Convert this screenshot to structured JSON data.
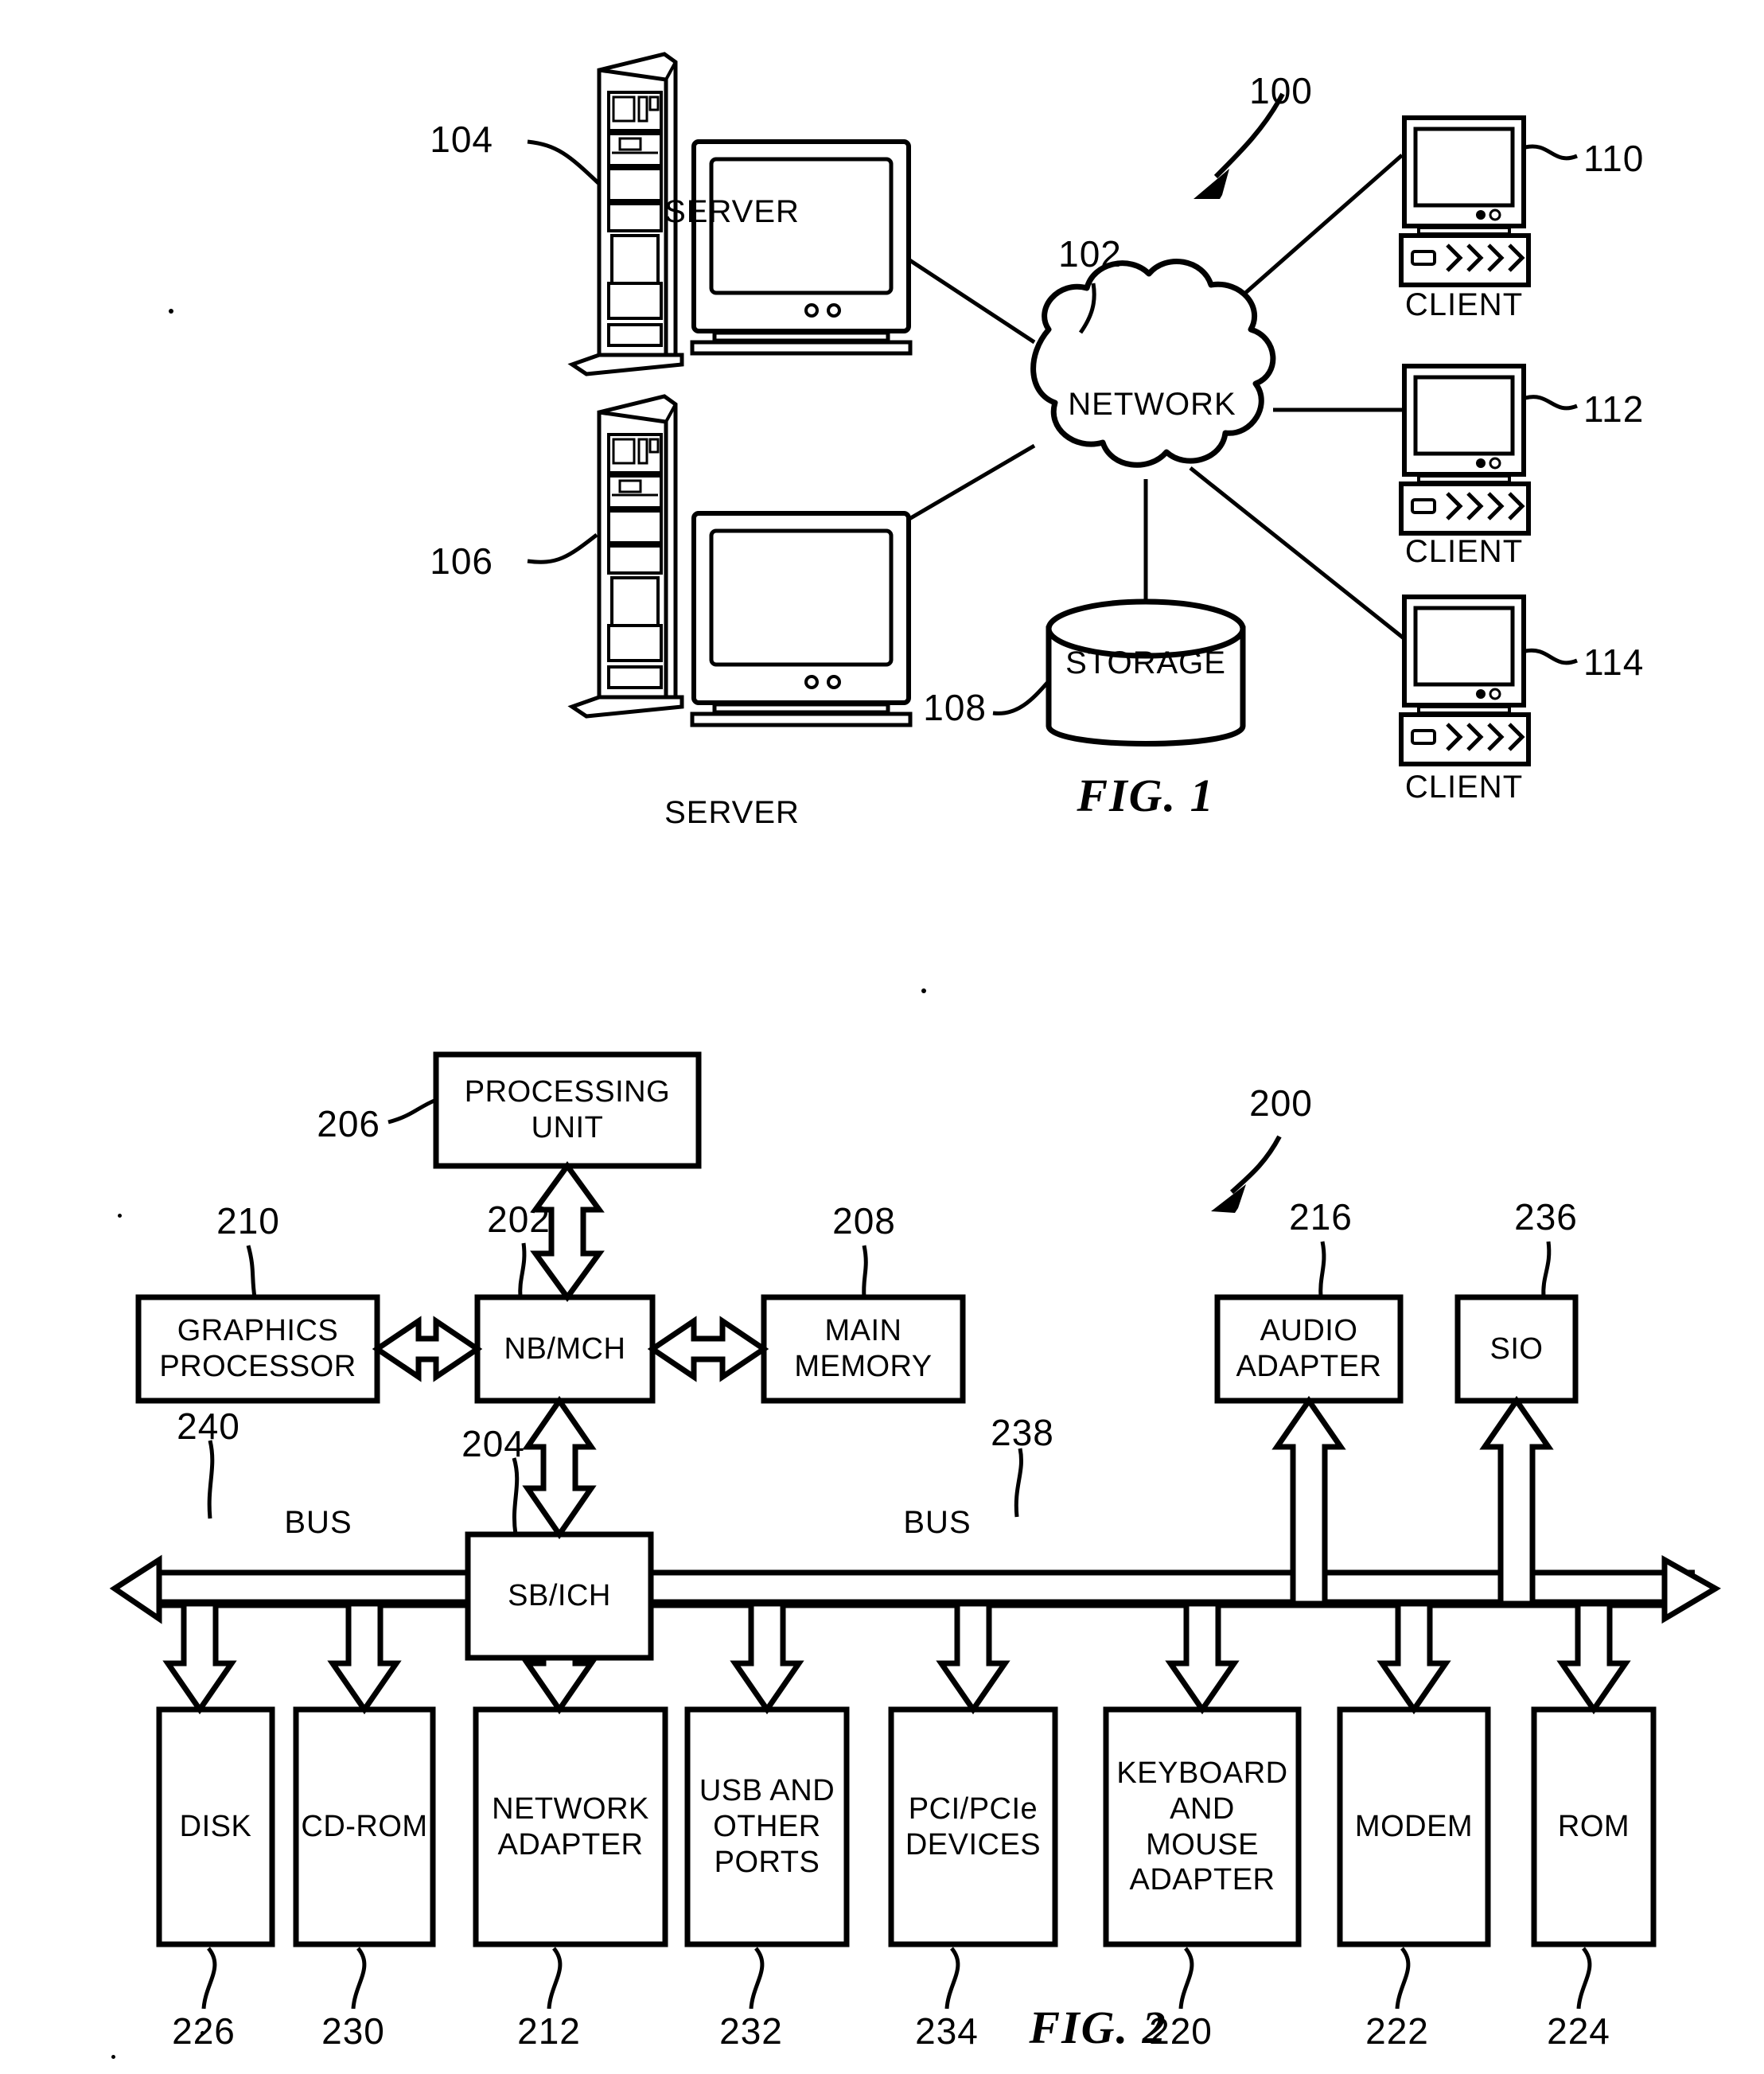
{
  "figures": [
    {
      "id": "fig-1",
      "caption": "FIG. 1",
      "system_ref": "100",
      "nodes": {
        "server_top": {
          "ref": "104",
          "label": "SERVER"
        },
        "server_bottom": {
          "ref": "106",
          "label": "SERVER"
        },
        "network": {
          "ref": "102",
          "label": "NETWORK"
        },
        "storage": {
          "ref": "108",
          "label": "STORAGE"
        },
        "client_1": {
          "ref": "110",
          "label": "CLIENT"
        },
        "client_2": {
          "ref": "112",
          "label": "CLIENT"
        },
        "client_3": {
          "ref": "114",
          "label": "CLIENT"
        }
      }
    },
    {
      "id": "fig-2",
      "caption": "FIG. 2",
      "system_ref": "200",
      "blocks": {
        "processing_unit": {
          "ref": "206",
          "label": "PROCESSING\nUNIT"
        },
        "graphics_processor": {
          "ref": "210",
          "label": "GRAPHICS\nPROCESSOR"
        },
        "nb_mch": {
          "ref": "202",
          "label": "NB/MCH"
        },
        "main_memory": {
          "ref": "208",
          "label": "MAIN\nMEMORY"
        },
        "audio_adapter": {
          "ref": "216",
          "label": "AUDIO\nADAPTER"
        },
        "sio": {
          "ref": "236",
          "label": "SIO"
        },
        "sb_ich": {
          "ref": "204",
          "label": "SB/ICH"
        },
        "bus_left": {
          "ref": "240",
          "label": "BUS"
        },
        "bus_right": {
          "ref": "238",
          "label": "BUS"
        },
        "disk": {
          "ref": "226",
          "label": "DISK"
        },
        "cdrom": {
          "ref": "230",
          "label": "CD-ROM"
        },
        "network_adapter": {
          "ref": "212",
          "label": "NETWORK\nADAPTER"
        },
        "usb_ports": {
          "ref": "232",
          "label": "USB AND\nOTHER\nPORTS"
        },
        "pci_devices": {
          "ref": "234",
          "label": "PCI/PCIe\nDEVICES"
        },
        "keyboard_mouse_adapter": {
          "ref": "220",
          "label": "KEYBOARD\nAND\nMOUSE\nADAPTER"
        },
        "modem": {
          "ref": "222",
          "label": "MODEM"
        },
        "rom": {
          "ref": "224",
          "label": "ROM"
        }
      }
    }
  ],
  "colors": {
    "ink": "#000000",
    "paper": "#ffffff"
  }
}
